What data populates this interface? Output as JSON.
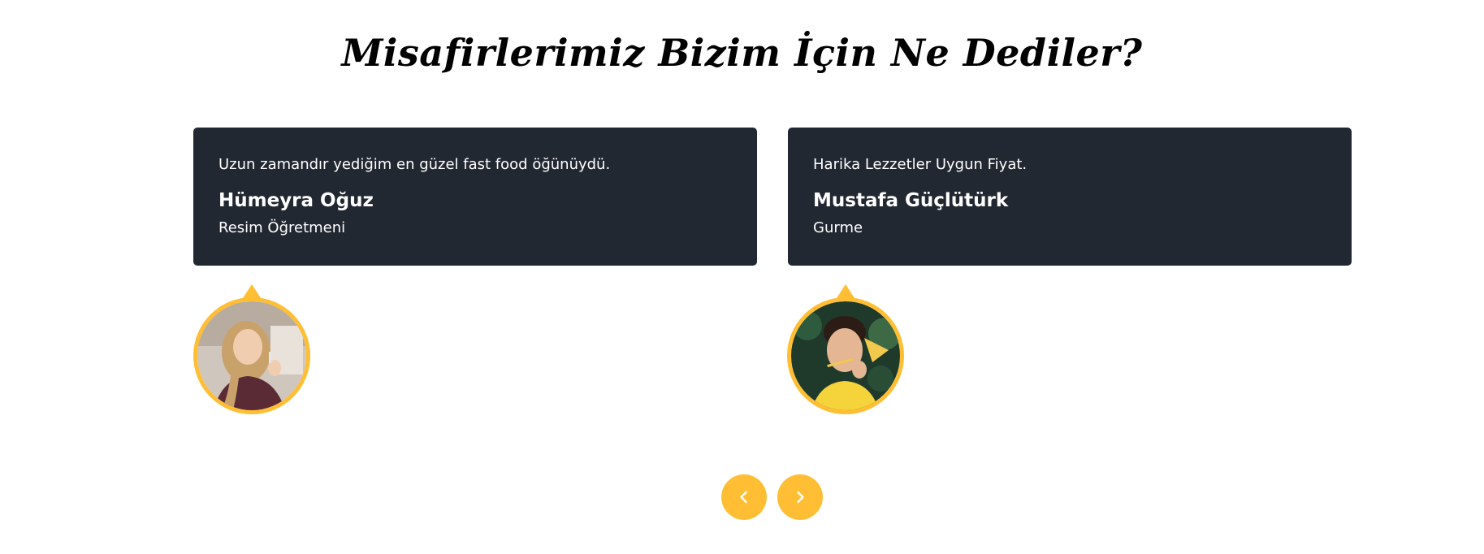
{
  "section": {
    "title": "Misafirlerimiz Bizim İçin Ne Dediler?"
  },
  "testimonials": [
    {
      "quote": "Uzun zamandır yediğim en güzel fast food öğünüydü.",
      "name": "Hümeyra Oğuz",
      "role": "Resim Öğretmeni",
      "avatar_icon": "woman-photo"
    },
    {
      "quote": "Harika Lezzetler Uygun Fiyat.",
      "name": "Mustafa Güçlütürk",
      "role": "Gurme",
      "avatar_icon": "man-photo"
    }
  ],
  "carousel": {
    "prev_icon": "chevron-left-icon",
    "next_icon": "chevron-right-icon"
  },
  "colors": {
    "accent": "#ffbe33",
    "card_background": "#222831",
    "card_text": "#ffffff",
    "title_text": "#000000"
  }
}
